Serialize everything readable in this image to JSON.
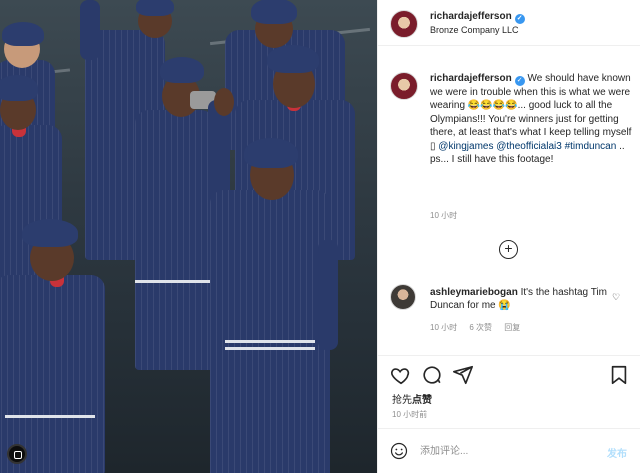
{
  "post": {
    "author": "richardajefferson",
    "location": "Bronze Company LLC",
    "caption_author": "richardajefferson",
    "caption_text_1": " We should have known we were in trouble when this is what we were wearing ",
    "caption_emojis": "😂😂😂😂",
    "caption_text_2": "... good luck to all the Olympians!!! You're winners just for getting there, at least that's what I keep telling myself ",
    "caption_placeholder_char": "▯",
    "mention_1": "@kingjames",
    "mention_2": "@theofficialai3",
    "hashtag": "#timduncan",
    "caption_text_3": " .. ps... I still have this footage!",
    "caption_time": "10 小时"
  },
  "comments": [
    {
      "author": "ashleymariebogan",
      "text": " It's the hashtag Tim Duncan for me ",
      "emoji": "😭",
      "time": "10 小时",
      "likes": "6 次赞",
      "reply": "回复"
    }
  ],
  "actions": {
    "likes_prefix": "抢先",
    "likes_action": "点赞",
    "post_time": "10 小时前"
  },
  "comment_box": {
    "placeholder": "添加评论...",
    "publish_label": "发布"
  },
  "colors": {
    "verified_blue": "#3897f0",
    "link_blue": "#00376b",
    "publish_disabled": "#b2dffc"
  }
}
